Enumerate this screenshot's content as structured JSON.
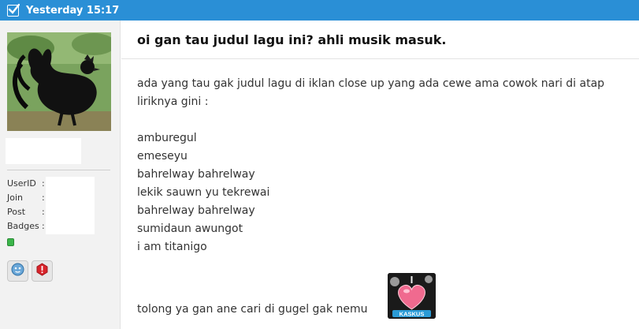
{
  "header": {
    "timestamp": "Yesterday 15:17",
    "check_icon": "checkbox-checked-icon",
    "background_color": "#2a8fd6"
  },
  "sidebar": {
    "avatar_icon": "rooster-avatar",
    "info_labels": {
      "userid": "UserID",
      "join": "Join",
      "post": "Post",
      "badges": "Badges"
    },
    "separator": ":",
    "online_status_color": "#3bb54a",
    "buttons": {
      "profile_icon": "profile-face-icon",
      "report_icon": "report-alert-icon"
    }
  },
  "post": {
    "title": "oi gan tau judul lagu ini? ahli musik masuk.",
    "intro_line1": "ada yang tau gak judul lagu di iklan close up yang ada cewe ama cowok nari di atap",
    "intro_line2": "liriknya gini :",
    "lyrics": [
      "amburegul",
      "emeseyu",
      "bahrelway bahrelway",
      "lekik sauwn yu tekrewai",
      "bahrelway bahrelway",
      "sumidaun awungot",
      "i am titanigo"
    ],
    "closing": "tolong ya gan ane cari di gugel gak nemu",
    "emoticon_icon": "kaskus-heart-emoticon",
    "emoticon_label": "KASKUS"
  }
}
